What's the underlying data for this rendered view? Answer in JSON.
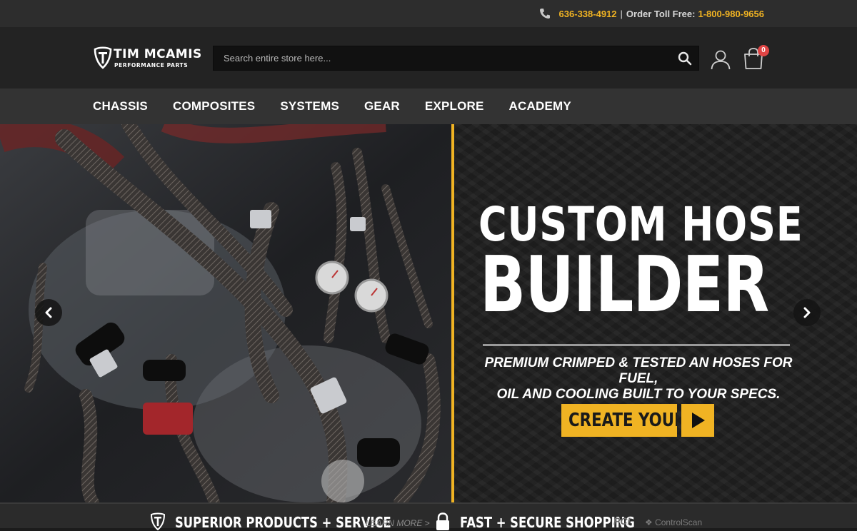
{
  "topbar": {
    "phone": "636-338-4912",
    "separator": "|",
    "toll_free_label": "Order Toll Free:",
    "toll_free_number": "1-800-980-9656",
    "phone_icon": "phone-icon"
  },
  "header": {
    "logo_name": "TIM MCAMIS",
    "logo_sub": "PERFORMANCE PARTS",
    "search_placeholder": "Search entire store here...",
    "search_icon": "search-icon",
    "user_icon": "user-icon",
    "cart_icon": "cart-icon",
    "cart_count": "0"
  },
  "nav": {
    "items": [
      "CHASSIS",
      "COMPOSITES",
      "SYSTEMS",
      "GEAR",
      "EXPLORE",
      "ACADEMY"
    ]
  },
  "hero": {
    "heading_line1": "CUSTOM HOSE",
    "heading_line2": "BUILDER",
    "tagline_line1": "PREMIUM CRIMPED & TESTED AN HOSES FOR FUEL,",
    "tagline_line2": "OIL AND COOLING BUILT TO YOUR SPECS.",
    "cta_label": "CREATE YOURS",
    "prev_icon": "chevron-left-icon",
    "next_icon": "chevron-right-icon",
    "accent_color": "#f0b323"
  },
  "strip": {
    "badge1": "SUPERIOR PRODUCTS + SERVICE",
    "learn_more": "LEARN MORE >",
    "badge2": "FAST + SECURE SHOPPING",
    "pci": "PCI",
    "controlscan": "ControlScan"
  }
}
